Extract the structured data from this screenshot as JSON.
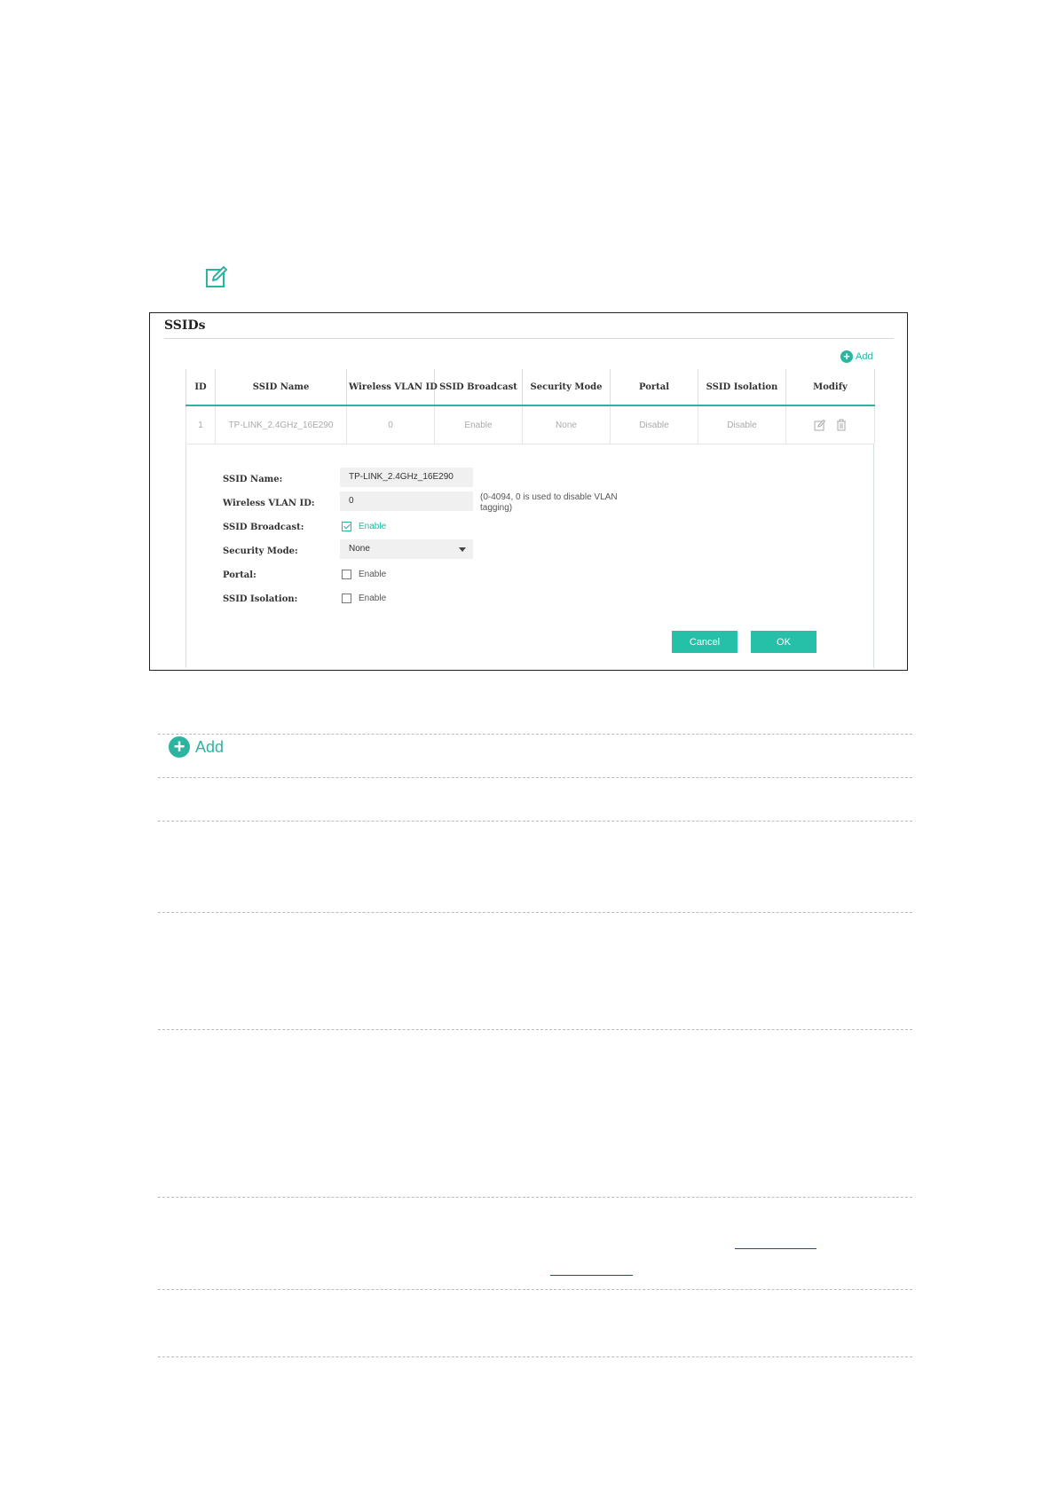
{
  "panel": {
    "title": "SSIDs",
    "add_label": "Add"
  },
  "table": {
    "headers": [
      "ID",
      "SSID Name",
      "Wireless VLAN ID",
      "SSID Broadcast",
      "Security Mode",
      "Portal",
      "SSID Isolation",
      "Modify"
    ],
    "row": [
      "1",
      "TP-LINK_2.4GHz_16E290",
      "0",
      "Enable",
      "None",
      "Disable",
      "Disable"
    ]
  },
  "form": {
    "ssid_name_label": "SSID Name:",
    "ssid_name_value": "TP-LINK_2.4GHz_16E290",
    "vlan_label": "Wireless VLAN ID:",
    "vlan_value": "0",
    "vlan_hint_line1": "(0-4094, 0 is used to disable VLAN",
    "vlan_hint_line2": "tagging)",
    "broadcast_label": "SSID Broadcast:",
    "broadcast_option": "Enable",
    "broadcast_checked": true,
    "security_label": "Security Mode:",
    "security_value": "None",
    "portal_label": "Portal:",
    "portal_option": "Enable",
    "portal_checked": false,
    "isolation_label": "SSID Isolation:",
    "isolation_option": "Enable",
    "isolation_checked": false,
    "cancel_label": "Cancel",
    "ok_label": "OK"
  },
  "doc": {
    "add_big_label": "Add"
  },
  "colors": {
    "accent": "#2bb5a0",
    "button": "#26c0a8",
    "link": "#1a3fbf"
  }
}
